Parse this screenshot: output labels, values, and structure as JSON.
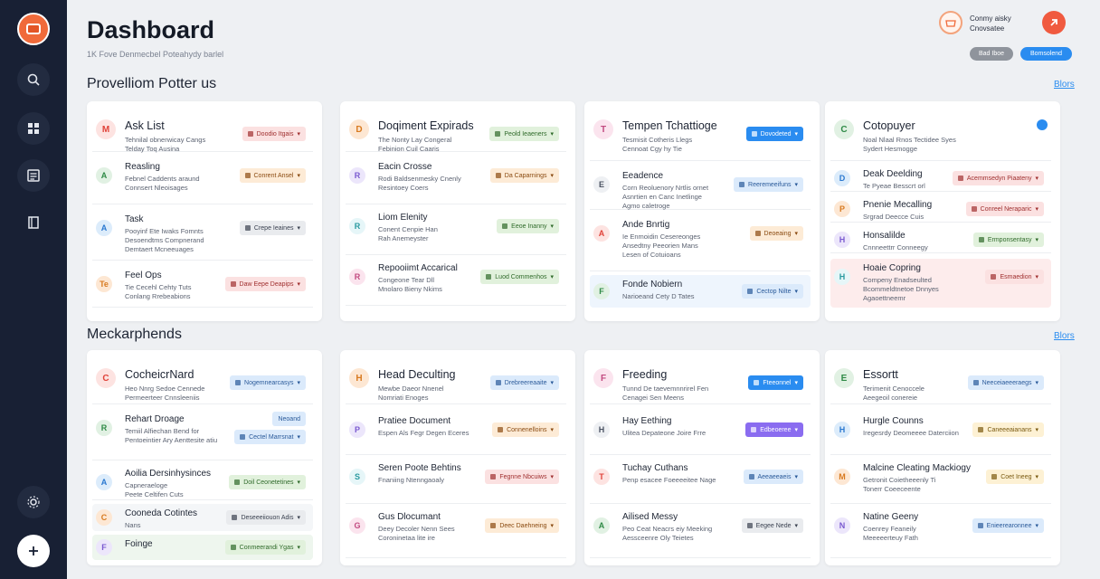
{
  "header": {
    "title": "Dashboard",
    "subtitle": "1K Fove Denmecbel Poteahydy barlel"
  },
  "account": {
    "line1": "Conmy aisky",
    "line2": "Cnovsatee",
    "pill_grey": "Bad Iboe",
    "pill_blue": "Bomsolend"
  },
  "sidebar": {
    "icons": [
      "logo-icon",
      "search-icon",
      "grid-icon",
      "list-icon",
      "book-icon",
      "settings-icon",
      "add-icon"
    ]
  },
  "section1": {
    "title": "Provelliom Potter us",
    "link": "Blors"
  },
  "section2": {
    "title": "Meckarphends",
    "link": "Blors"
  },
  "cards1": [
    {
      "head": {
        "icon": "M",
        "title": "Ask List",
        "l1": "Tehnilal obnerwicay Cangs",
        "l2": "Telday Toq Ausina",
        "tag": "Doodio Itgais",
        "tag_style": "t-red"
      },
      "rows": [
        {
          "icon": "A",
          "title": "Reasling",
          "l1": "Febnel Caddents araund",
          "l2": "Connsert Nleoisages",
          "tag": "Conrent Ansel",
          "tag_style": "t-orange"
        },
        {
          "icon": "A",
          "title": "Task",
          "l1": "Pooyinf Ete Iwaks Fomnts",
          "l2": "Desoendtms Compnerand",
          "l3": "Demtaert Mcneeuages",
          "tag": "Crepe Ieaines",
          "tag_style": "t-grey"
        },
        {
          "icon": "Te",
          "title": "Feel Ops",
          "l1": "Tie Cecehl Cehty Tuts",
          "l2": "Conlang Rrebeabions",
          "tag": "Daw Eepe Deapips",
          "tag_style": "t-red"
        }
      ]
    },
    {
      "head": {
        "icon": "D",
        "title": "Doqiment Expirads",
        "l1": "The Nonty Lay Congeral",
        "l2": "Febinion Cuil Caaris",
        "tag": "Peold Ieaeners",
        "tag_style": "t-green"
      },
      "rows": [
        {
          "icon": "R",
          "title": "Eacin Crosse",
          "l1": "Rodi Baldsenmesky Cnenly",
          "l2": "Resintoey Coers",
          "tag": "Da Caparnings",
          "tag_style": "t-orange"
        },
        {
          "icon": "R",
          "title": "Liom Elenity",
          "l1": "Conent Cenpie Han",
          "l2": "Rah Anemeyster",
          "tag": "Eeoe Inanny",
          "tag_style": "t-green"
        },
        {
          "icon": "R",
          "title": "Repooiimt Accarical",
          "l1": "Congeone Tear Dll",
          "l2": "Mnolaro Bieny Nkims",
          "tag": "Luod Commenhos",
          "tag_style": "t-green"
        }
      ]
    },
    {
      "head": {
        "icon": "T",
        "title": "Tempen Tchattioge",
        "l1": "Tesmisit Cotheris Llegs",
        "l2": "Cennoat Cgy hy Tie",
        "tag": "Dovodeted",
        "tag_style": "t-blue-solid"
      },
      "rows": [
        {
          "icon": "E",
          "title": "Eeadence",
          "l1": "Corn Reoluenory Nrtlis ornet",
          "l2": "Asnrtien en Canc Inetlinge",
          "l3": "Agmo caletroge",
          "tag": "Reeremeeifuns",
          "tag_style": "t-blue"
        },
        {
          "icon": "A",
          "title": "Ande Bnrtig",
          "l1": "Ie Enmoidin Cesereonges",
          "l2": "Ansedtny Peeorien Mans",
          "l3": "Lesen of Cotuioans",
          "tag": "Deoeaing",
          "tag_style": "t-orange"
        },
        {
          "icon": "F",
          "title": "Fonde Nobiern",
          "l1": "Narioeand Cety D Tates",
          "l2": "",
          "tag": "Cectop Nilte",
          "tag_style": "t-blue"
        }
      ]
    },
    {
      "head": {
        "icon": "C",
        "title": "Cotopuyer",
        "l1": "Noal Nlaal Rnos Tectidee Syes",
        "l2": "Sydert Hesmogge",
        "tag": "",
        "tag_style": ""
      },
      "rows": [
        {
          "icon": "D",
          "title": "Deak Deelding",
          "l1": "Te Pyeae Besscrt orl",
          "l2": "",
          "tag": "Acemmsedyn Piaateny",
          "tag_style": "t-red"
        },
        {
          "icon": "P",
          "title": "Pnenie Mecalling",
          "l1": "Srgrad Deecce Cuis",
          "l2": "",
          "tag": "Conreel Neraparic",
          "tag_style": "t-red"
        },
        {
          "icon": "H",
          "title": "Honsalilde",
          "l1": "Cnnneettrr Conneegy",
          "l2": "",
          "tag": "Ermponsentasy",
          "tag_style": "t-green"
        },
        {
          "icon": "H",
          "title": "Hoaie Copring",
          "l1": "Compeny Enadseulted",
          "l2": "Bcommeldtnetoe Dnnyes",
          "l3": "Agaoettneemr",
          "tag": "Esmaedion",
          "tag_style": "t-red"
        }
      ]
    }
  ],
  "cards2": [
    {
      "head": {
        "icon": "C",
        "title": "CocheicrNard",
        "l1": "Heo Nnrg Sedoe Cennede",
        "l2": "Permeerteer Cnnsleeniis",
        "tag": "Nogemnearcasys",
        "tag_style": "t-blue"
      },
      "rows": [
        {
          "icon": "R",
          "title": "Rehart Droage",
          "l1": "Temiil Alfiechan Bend for",
          "l2": "Pentoeintier Ary Aenttesite atiu",
          "tag": "Cectel Marrsnat",
          "tag_style": "t-blue",
          "tag2": "Neoand"
        },
        {
          "icon": "A",
          "title": "Aoilia Dersinhysinces",
          "l1": "Capneraeloge",
          "l2": "Peete Celtifen Cuts",
          "tag": "Doil Ceonetetines",
          "tag_style": "t-green"
        },
        {
          "icon": "C",
          "title": "Cooneda Cotintes",
          "l1": "Nans",
          "l2": "",
          "tag": "Deseeeiiouon Adis",
          "tag_style": "t-grey"
        },
        {
          "icon": "F",
          "title": "Foinge",
          "l1": "",
          "l2": "",
          "tag": "Conmeerandi Ygas",
          "tag_style": "t-green"
        }
      ]
    },
    {
      "head": {
        "icon": "H",
        "title": "Head Deculting",
        "l1": "Mewbe Daeor Nnenel",
        "l2": "Nomriati Enoges",
        "tag": "Drebreereaaite",
        "tag_style": "t-blue"
      },
      "rows": [
        {
          "icon": "P",
          "title": "Pratiee Document",
          "l1": "Espen Als Fegr Degen Eceres",
          "l2": "",
          "tag": "Connenelloins",
          "tag_style": "t-orange"
        },
        {
          "icon": "S",
          "title": "Seren Poote Behtins",
          "l1": "Fnaniing Ntenngaoaly",
          "l2": "",
          "tag": "Fegnne Nbcuiws",
          "tag_style": "t-red"
        },
        {
          "icon": "G",
          "title": "Gus Dlocumant",
          "l1": "Deey Decoler Nenn Sees",
          "l2": "Coroninetaa lite ire",
          "tag": "Deec Daehneing",
          "tag_style": "t-orange"
        }
      ]
    },
    {
      "head": {
        "icon": "F",
        "title": "Freeding",
        "l1": "Tunnd De taevemnnrirel Fen",
        "l2": "Cenagei Sen Meens",
        "tag": "Fteeonnel",
        "tag_style": "t-blue-solid"
      },
      "rows": [
        {
          "icon": "H",
          "title": "Hay Eething",
          "l1": "Ulitea Depateone Joire Frre",
          "l2": "",
          "tag": "Edbeoeree",
          "tag_style": "t-purple"
        },
        {
          "icon": "T",
          "title": "Tuchay Cuthans",
          "l1": "Penp esacee Foeeeeitee Nage",
          "l2": "",
          "tag": "Aeeaeeaeis",
          "tag_style": "t-blue"
        },
        {
          "icon": "A",
          "title": "Ailised Messy",
          "l1": "Peo Ceat Neacrs eiy Meeking",
          "l2": "Aessceenre Oly Teietes",
          "tag": "Eegee Nede",
          "tag_style": "t-grey"
        }
      ]
    },
    {
      "head": {
        "icon": "E",
        "title": "Essortt",
        "l1": "Terimenit Cenoccele",
        "l2": "Aeegeoil conereie",
        "tag": "Neeceiaeeeraegs",
        "tag_style": "t-blue"
      },
      "rows": [
        {
          "icon": "H",
          "title": "Hurgle Counns",
          "l1": "Iregesrdy Deomeeee Daterciion",
          "l2": "",
          "tag": "Caneeeaianans",
          "tag_style": "t-yellow"
        },
        {
          "icon": "M",
          "title": "Malcine Cleating Mackiogy",
          "l1": "Getronit Coietheeenly Ti",
          "l2": "Tonerr Coeeceente",
          "tag": "Coet Ineeg",
          "tag_style": "t-yellow"
        },
        {
          "icon": "N",
          "title": "Natine Geeny",
          "l1": "Coenrey Feaneily",
          "l2": "Meeeeerteuy Fath",
          "tag": "Enieerearonnee",
          "tag_style": "t-blue"
        }
      ]
    }
  ],
  "colors": {
    "sidebar": "#182034",
    "accent_orange": "#f06a3a",
    "accent_blue": "#2a8cf0",
    "accent_red": "#f05a3f"
  }
}
